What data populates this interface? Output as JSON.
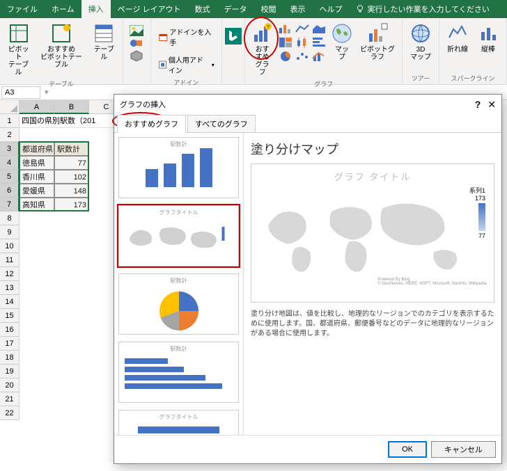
{
  "tabs": [
    "ファイル",
    "ホーム",
    "挿入",
    "ページ レイアウト",
    "数式",
    "データ",
    "校閲",
    "表示",
    "ヘルプ"
  ],
  "active_tab": "挿入",
  "tell_me": "実行したい作業を入力してください",
  "ribbon": {
    "tables": {
      "label": "テーブル",
      "pivot": "ピボット\nテーブル",
      "rec_pivot": "おすすめ\nピボットテーブル",
      "table": "テーブル"
    },
    "addins": {
      "label": "アドイン",
      "get": "アドインを入手",
      "my": "個人用アドイン"
    },
    "charts": {
      "label": "グラフ",
      "rec": "おすすめ\nグラフ",
      "map": "マップ",
      "pivot": "ピボットグラフ"
    },
    "tours": {
      "label": "ツアー",
      "map3d": "3D\nマップ"
    },
    "spark": {
      "label": "スパークライン",
      "line": "折れ線",
      "col": "縦棒"
    }
  },
  "name_box": "A3",
  "sheet": {
    "cols": [
      "A",
      "B",
      "C"
    ],
    "title_cell": "四国の県別駅数（201",
    "header_pref": "都道府県",
    "header_cnt": "駅数計",
    "rows": [
      {
        "pref": "徳島県",
        "cnt": 77
      },
      {
        "pref": "香川県",
        "cnt": 102
      },
      {
        "pref": "愛媛県",
        "cnt": 148
      },
      {
        "pref": "高知県",
        "cnt": 173
      }
    ]
  },
  "dialog": {
    "title": "グラフの挿入",
    "tab_rec": "おすすめグラフ",
    "tab_all": "すべてのグラフ",
    "thumbs": {
      "bar_title": "駅数計",
      "map_title": "グラフタイトル",
      "pie_title": "駅数計",
      "hbar_title": "駅数計",
      "funnel_title": "グラフタイトル"
    },
    "preview_title": "塗り分けマップ",
    "chart_title": "グラフ タイトル",
    "legend_series": "系列1",
    "legend_max": "173",
    "legend_min": "77",
    "credit_powered": "Powered By Bing",
    "credit_src": "© GeoNames, HERE, MSFT, Microsoft, NavInfo, Wikipedia",
    "desc": "塗り分け地図は、値を比較し、地理的なリージョンでのカテゴリを表示するために使用します。国、都道府県、郵便番号などのデータに地理的なリージョンがある場合に使用します。",
    "ok": "OK",
    "cancel": "キャンセル"
  },
  "chart_data": {
    "type": "bar",
    "categories": [
      "徳島県",
      "香川県",
      "愛媛県",
      "高知県"
    ],
    "values": [
      77,
      102,
      148,
      173
    ],
    "title": "駅数計"
  }
}
